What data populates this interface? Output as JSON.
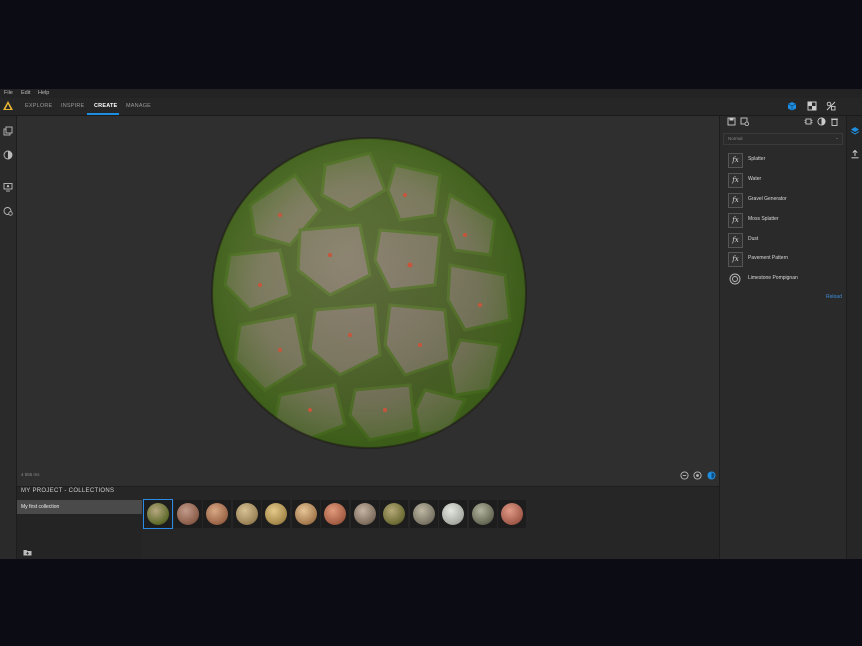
{
  "menu": {
    "file": "File",
    "edit": "Edit",
    "help": "Help"
  },
  "tabs": [
    {
      "label": "EXPLORE"
    },
    {
      "label": "INSPIRE"
    },
    {
      "label": "CREATE"
    },
    {
      "label": "MANAGE"
    }
  ],
  "active_tab": "CREATE",
  "viewport": {
    "render_time": "4 555 ms"
  },
  "collections": {
    "header": "MY PROJECT - COLLECTIONS",
    "selected": "My first collection",
    "thumbnail_count": 13
  },
  "right_panel": {
    "blend_mode": "Normal",
    "layers": [
      {
        "icon": "fx-icon",
        "label": "Splatter"
      },
      {
        "icon": "fx-icon",
        "label": "Water"
      },
      {
        "icon": "fx-icon",
        "label": "Gravel Generator"
      },
      {
        "icon": "fx-icon",
        "label": "Moss Splatter"
      },
      {
        "icon": "fx-icon",
        "label": "Dust"
      },
      {
        "icon": "fx-icon",
        "label": "Pavement Pattern"
      },
      {
        "icon": "material-icon",
        "label": "Limestone Pompignan"
      }
    ],
    "reload": "Reload"
  },
  "colors": {
    "accent": "#1e8fe0",
    "background": "#2b2b2b",
    "viewport": "#2f2f2f"
  }
}
